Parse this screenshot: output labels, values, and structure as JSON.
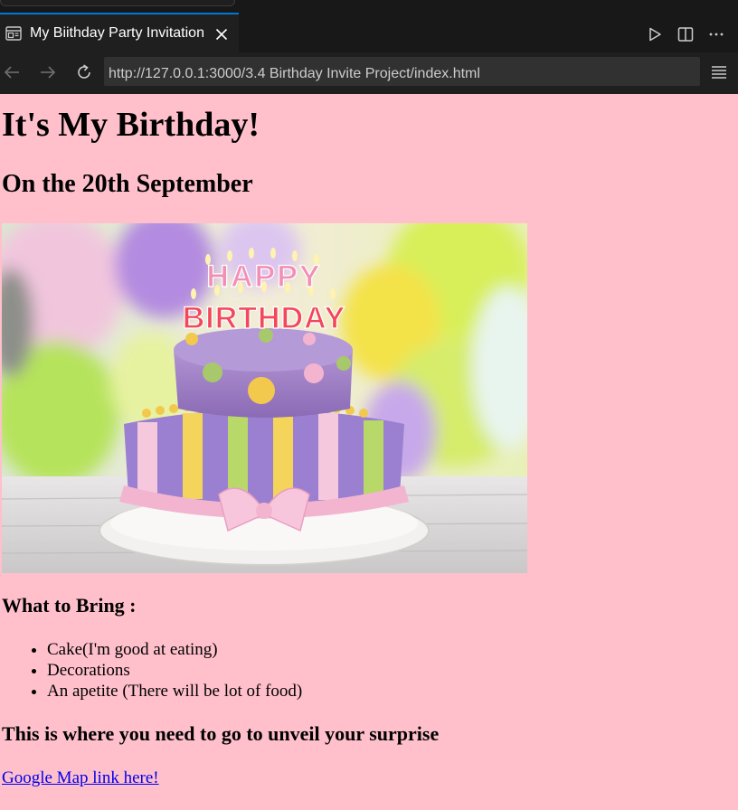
{
  "tab": {
    "title": "My Biithday Party Invitation"
  },
  "address_bar": {
    "url": "http://127.0.0.1:3000/3.4 Birthday Invite Project/index.html"
  },
  "icons": {
    "tab": "preview-icon",
    "close": "close-icon",
    "run": "play-icon",
    "split": "split-editor-icon",
    "more": "more-actions-icon",
    "back": "arrow-left-icon",
    "forward": "arrow-right-icon",
    "reload": "reload-icon",
    "menu": "menu-icon"
  },
  "page": {
    "heading": "It's My Birthday!",
    "date": "On the 20th September",
    "image": {
      "cake_text_top": "HAPPY",
      "cake_text_bottom": "BIRTHDAY"
    },
    "bring_heading": "What to Bring :",
    "bring_items": [
      "Cake(I'm good at eating)",
      "Decorations",
      "An apetite (There will be lot of food)"
    ],
    "surprise_heading": "This is where you need to go to unveil your surprise",
    "map_link": "Google Map link here!"
  },
  "colors": {
    "page_background": "#ffc0cb",
    "link": "#0000ee",
    "chrome": "#1f1f1f",
    "active_tab_border": "#0078d4"
  }
}
